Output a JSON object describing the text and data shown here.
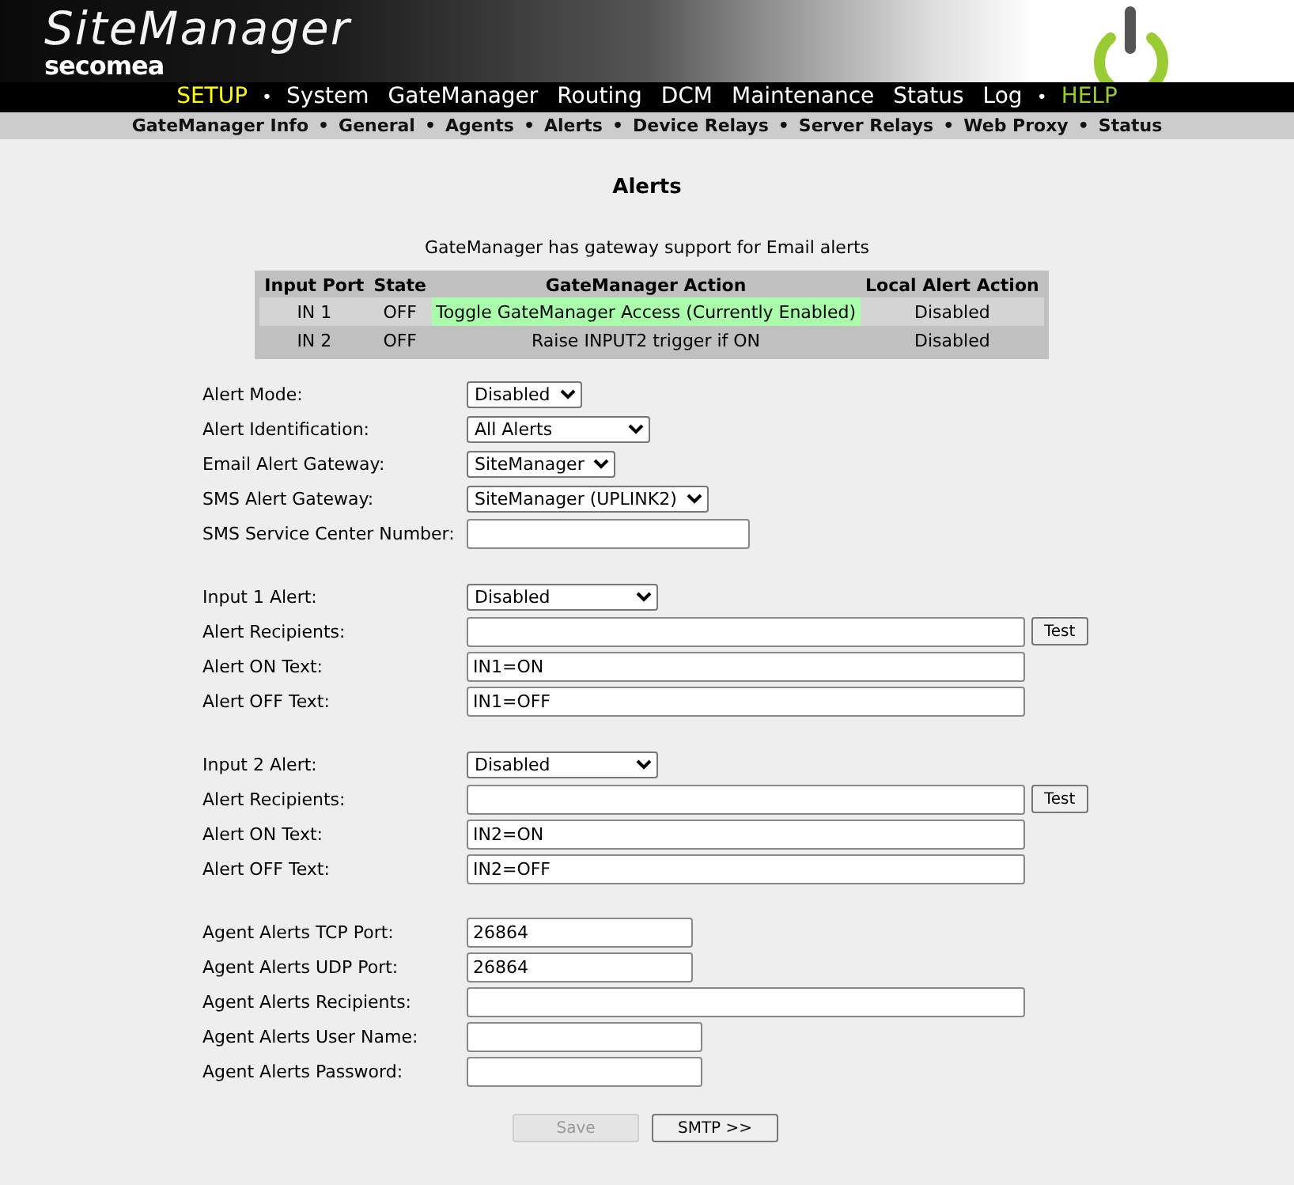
{
  "header": {
    "title": "SiteManager",
    "brand": "secomea"
  },
  "menu": [
    {
      "label": "SETUP",
      "kind": "link",
      "selected": true
    },
    {
      "label": "•",
      "kind": "separator"
    },
    {
      "label": "System",
      "kind": "link",
      "selected": false
    },
    {
      "label": "GateManager",
      "kind": "link",
      "selected": false
    },
    {
      "label": "Routing",
      "kind": "link",
      "selected": false
    },
    {
      "label": "DCM",
      "kind": "link",
      "selected": false
    },
    {
      "label": "Maintenance",
      "kind": "link",
      "selected": false
    },
    {
      "label": "Status",
      "kind": "link",
      "selected": false
    },
    {
      "label": "Log",
      "kind": "link",
      "selected": false
    },
    {
      "label": "•",
      "kind": "separator"
    },
    {
      "label": "HELP",
      "kind": "help"
    }
  ],
  "submenu": {
    "separator": "•",
    "items": [
      "GateManager Info",
      "General",
      "Agents",
      "Alerts",
      "Device Relays",
      "Server Relays",
      "Web Proxy",
      "Status"
    ]
  },
  "page_title": "Alerts",
  "note": "GateManager has gateway support for Email alerts",
  "table": {
    "columns": [
      "Input Port",
      "State",
      "GateManager Action",
      "Local Alert Action"
    ],
    "rows": [
      [
        {
          "text": "IN 1",
          "highlighted": false
        },
        {
          "text": "OFF",
          "highlighted": false
        },
        {
          "text": "Toggle GateManager Access (Currently Enabled)",
          "highlighted": true
        },
        {
          "text": "Disabled",
          "highlighted": false
        }
      ],
      [
        {
          "text": "IN 2",
          "highlighted": false
        },
        {
          "text": "OFF",
          "highlighted": false
        },
        {
          "text": "Raise INPUT2 trigger if ON",
          "highlighted": false
        },
        {
          "text": "Disabled",
          "highlighted": false
        }
      ]
    ]
  },
  "form_groups": [
    [
      {
        "label": "Alert Mode:",
        "kind": "select",
        "value": "Disabled"
      },
      {
        "label": "Alert Identification:",
        "kind": "select",
        "value": "All Alerts"
      },
      {
        "label": "Email Alert Gateway:",
        "kind": "select",
        "value": "SiteManager"
      },
      {
        "label": "SMS Alert Gateway:",
        "kind": "select",
        "value": "SiteManager (UPLINK2)"
      },
      {
        "label": "SMS Service Center Number:",
        "kind": "text"
      }
    ],
    [
      {
        "label": "Input 1 Alert:",
        "kind": "select",
        "value": "Disabled"
      },
      {
        "label": "Alert Recipients:",
        "kind": "text",
        "button": "Test"
      },
      {
        "label": "Alert ON Text:",
        "kind": "text",
        "value": "IN1=ON"
      },
      {
        "label": "Alert OFF Text:",
        "kind": "text",
        "value": "IN1=OFF"
      }
    ],
    [
      {
        "label": "Input 2 Alert:",
        "kind": "select",
        "value": "Disabled"
      },
      {
        "label": "Alert Recipients:",
        "kind": "text",
        "button": "Test"
      },
      {
        "label": "Alert ON Text:",
        "kind": "text",
        "value": "IN2=ON"
      },
      {
        "label": "Alert OFF Text:",
        "kind": "text",
        "value": "IN2=OFF"
      }
    ],
    [
      {
        "label": "Agent Alerts TCP Port:",
        "kind": "text",
        "value": "26864"
      },
      {
        "label": "Agent Alerts UDP Port:",
        "kind": "text",
        "value": "26864"
      },
      {
        "label": "Agent Alerts Recipients:",
        "kind": "text"
      },
      {
        "label": "Agent Alerts User Name:",
        "kind": "text"
      },
      {
        "label": "Agent Alerts Password:",
        "kind": "text"
      }
    ]
  ],
  "buttons": [
    {
      "label": "Save",
      "disabled": true
    },
    {
      "label": "SMTP >>",
      "disabled": false
    }
  ]
}
